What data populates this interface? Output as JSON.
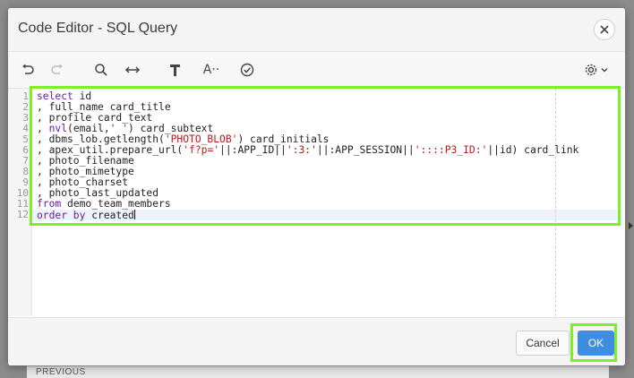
{
  "dialog": {
    "title": "Code Editor - SQL Query"
  },
  "toolbar": {
    "undo": "undo-icon",
    "redo": "redo-icon",
    "search": "search-icon",
    "replace": "swap-icon",
    "format": "hammer-icon",
    "hint_label": "A··",
    "validate": "check-circle-icon",
    "settings": "gear-icon"
  },
  "editor": {
    "line_numbers": [
      "1",
      "2",
      "3",
      "4",
      "5",
      "6",
      "7",
      "8",
      "9",
      "10",
      "11",
      "12"
    ],
    "lines": [
      [
        {
          "t": "kw",
          "v": "select"
        },
        {
          "t": "n",
          "v": " id"
        }
      ],
      [
        {
          "t": "n",
          "v": ", full_name card_title"
        }
      ],
      [
        {
          "t": "n",
          "v": ", profile card_text"
        }
      ],
      [
        {
          "t": "n",
          "v": ", "
        },
        {
          "t": "kw",
          "v": "nvl"
        },
        {
          "t": "n",
          "v": "(email,"
        },
        {
          "t": "str",
          "v": "' '"
        },
        {
          "t": "n",
          "v": ") card_subtext"
        }
      ],
      [
        {
          "t": "n",
          "v": ", dbms_lob.getlength("
        },
        {
          "t": "str",
          "v": "'PHOTO_BLOB'"
        },
        {
          "t": "n",
          "v": ") card_initials"
        }
      ],
      [
        {
          "t": "n",
          "v": ", apex_util.prepare_url("
        },
        {
          "t": "str",
          "v": "'f?p='"
        },
        {
          "t": "n",
          "v": "||:APP_ID||"
        },
        {
          "t": "str",
          "v": "':3:'"
        },
        {
          "t": "n",
          "v": "||:APP_SESSION||"
        },
        {
          "t": "str",
          "v": "'::::P3_ID:'"
        },
        {
          "t": "n",
          "v": "||id) card_link"
        }
      ],
      [
        {
          "t": "n",
          "v": ", photo_filename"
        }
      ],
      [
        {
          "t": "n",
          "v": ", photo_mimetype"
        }
      ],
      [
        {
          "t": "n",
          "v": ", photo_charset"
        }
      ],
      [
        {
          "t": "n",
          "v": ", photo_last_updated"
        }
      ],
      [
        {
          "t": "kw",
          "v": "from"
        },
        {
          "t": "n",
          "v": " demo_team_members"
        }
      ],
      [
        {
          "t": "kw",
          "v": "order by"
        },
        {
          "t": "n",
          "v": " created"
        }
      ]
    ]
  },
  "footer": {
    "cancel_label": "Cancel",
    "ok_label": "OK"
  },
  "background": {
    "behind_label": "PREVIOUS"
  },
  "colors": {
    "highlight": "#7cf024",
    "primary_button": "#3f8de0",
    "keyword": "#6a1b9a",
    "string": "#b71c1c"
  }
}
